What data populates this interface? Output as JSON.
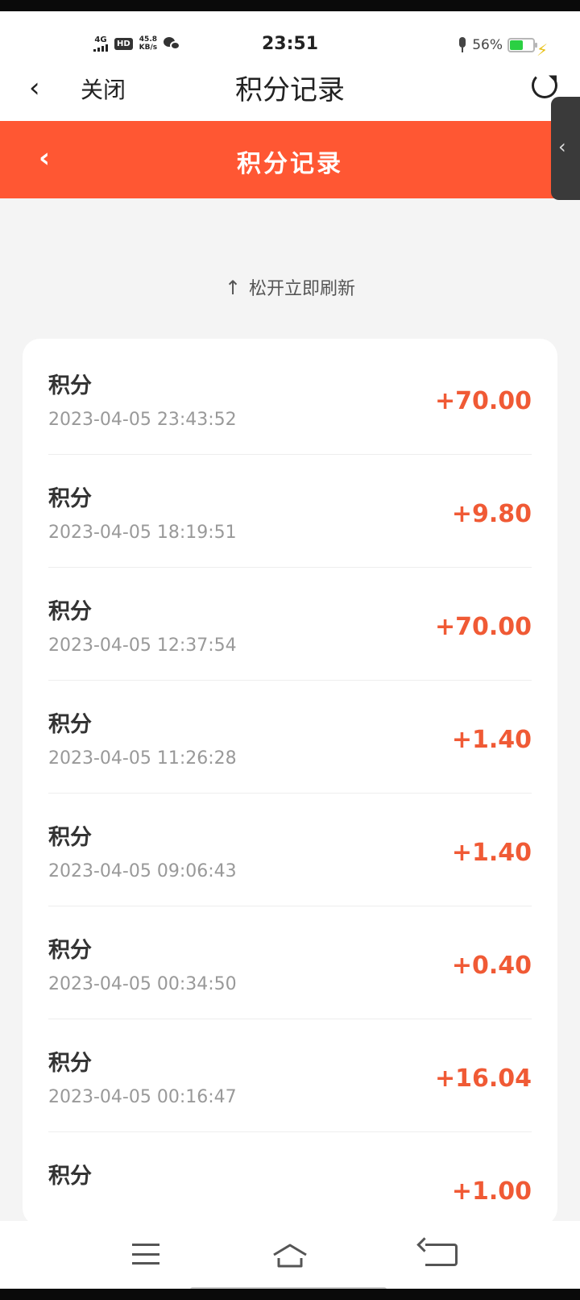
{
  "status_bar": {
    "network": "4G",
    "hd": "HD",
    "speed_value": "45.8",
    "speed_unit": "KB/s",
    "time": "23:51",
    "battery_percent": "56%",
    "battery_level": 0.56,
    "colors": {
      "battery_fill": "#2bd043",
      "charging_bolt": "#e9c21a"
    }
  },
  "nav": {
    "back_icon": "chevron-left-icon",
    "close_label": "关闭",
    "title": "积分记录",
    "refresh_icon": "refresh-icon"
  },
  "header": {
    "back_icon": "chevron-left-icon",
    "title": "积分记录",
    "color": "#ff5733"
  },
  "pull_hint": {
    "arrow": "↑",
    "text": "松开立即刷新"
  },
  "records": [
    {
      "title": "积分",
      "date": "2023-04-05 23:43:52",
      "amount": "+70.00"
    },
    {
      "title": "积分",
      "date": "2023-04-05 18:19:51",
      "amount": "+9.80"
    },
    {
      "title": "积分",
      "date": "2023-04-05 12:37:54",
      "amount": "+70.00"
    },
    {
      "title": "积分",
      "date": "2023-04-05 11:26:28",
      "amount": "+1.40"
    },
    {
      "title": "积分",
      "date": "2023-04-05 09:06:43",
      "amount": "+1.40"
    },
    {
      "title": "积分",
      "date": "2023-04-05 00:34:50",
      "amount": "+0.40"
    },
    {
      "title": "积分",
      "date": "2023-04-05 00:16:47",
      "amount": "+16.04"
    },
    {
      "title": "积分",
      "date": "",
      "amount": "+1.00"
    }
  ],
  "amount_color": "#f05a35"
}
